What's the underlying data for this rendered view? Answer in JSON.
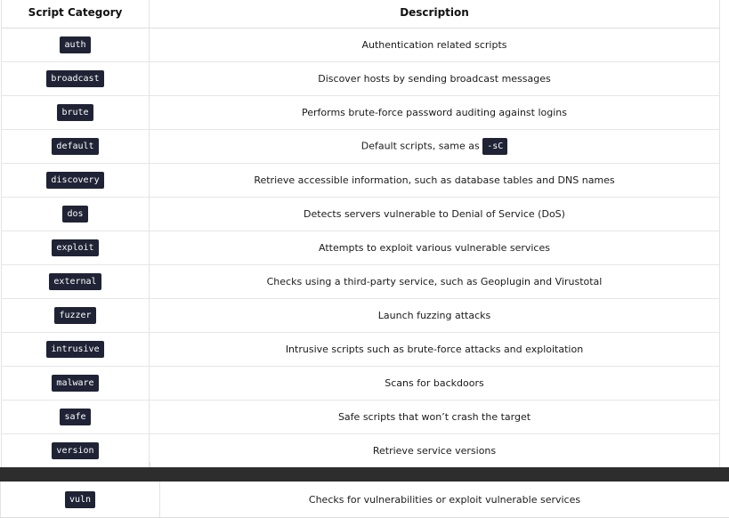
{
  "table": {
    "headers": {
      "category": "Script Category",
      "description": "Description"
    },
    "rows": [
      {
        "category": "auth",
        "description": "Authentication related scripts"
      },
      {
        "category": "broadcast",
        "description": "Discover hosts by sending broadcast messages"
      },
      {
        "category": "brute",
        "description": "Performs brute-force password auditing against logins"
      },
      {
        "category": "default",
        "description": "Default scripts, same as ",
        "inline_code": "-sC"
      },
      {
        "category": "discovery",
        "description": "Retrieve accessible information, such as database tables and DNS names"
      },
      {
        "category": "dos",
        "description": "Detects servers vulnerable to Denial of Service (DoS)"
      },
      {
        "category": "exploit",
        "description": "Attempts to exploit various vulnerable services"
      },
      {
        "category": "external",
        "description": "Checks using a third-party service, such as Geoplugin and Virustotal"
      },
      {
        "category": "fuzzer",
        "description": "Launch fuzzing attacks"
      },
      {
        "category": "intrusive",
        "description": "Intrusive scripts such as brute-force attacks and exploitation"
      },
      {
        "category": "malware",
        "description": "Scans for backdoors"
      },
      {
        "category": "safe",
        "description": "Safe scripts that won’t crash the target"
      },
      {
        "category": "version",
        "description": "Retrieve service versions"
      }
    ]
  },
  "bottom_row": {
    "category": "vuln",
    "description": "Checks for vulnerabilities or exploit vulnerable services"
  },
  "colors": {
    "code_background": "#1f2335",
    "divider_bar": "#2d2d2d"
  }
}
